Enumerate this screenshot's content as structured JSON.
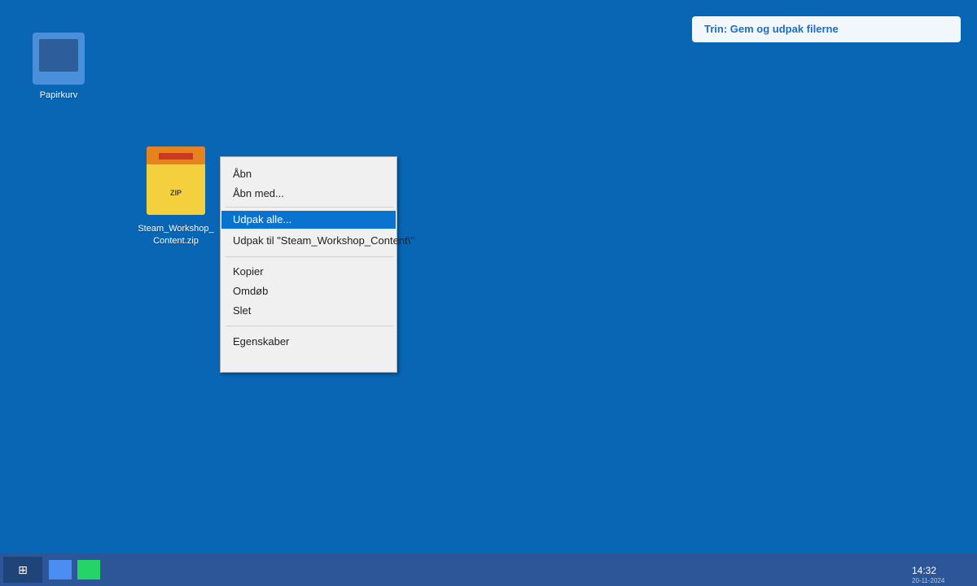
{
  "desktop": {
    "icons": [
      {
        "label": "Papirkurv",
        "icon": "recycle-bin-icon"
      },
      {
        "label": "Steam_Workshop_\nContent.zip",
        "icon": "zip-file-icon",
        "badge": "ZIP"
      }
    ]
  },
  "step_banner": {
    "text": "Trin: Gem og udpak filerne"
  },
  "context_menu": {
    "items": [
      {
        "label": "Åbn"
      },
      {
        "label": "Åbn med..."
      },
      {
        "label": "Udpak alle...",
        "selected": true
      },
      {
        "label": "Udpak til \"Steam_Workshop_Content\\\""
      },
      {
        "label": "Kopier"
      },
      {
        "label": "Omdøb"
      },
      {
        "label": "Slet"
      },
      {
        "label": "Egenskaber"
      }
    ]
  },
  "taskbar": {
    "start_icon": "⊞",
    "apps": [
      {
        "icon": "app-blue-icon",
        "color": "#4b8df0"
      },
      {
        "icon": "app-green-icon",
        "color": "#25d366"
      }
    ],
    "clock": {
      "time": "14:32",
      "date": "20-11-2024"
    }
  },
  "colors": {
    "desktop_bg": "#0866b5",
    "taskbar_bg": "#2c5697",
    "menu_selected": "#0a73d0",
    "banner_text": "#1a6fc4"
  }
}
